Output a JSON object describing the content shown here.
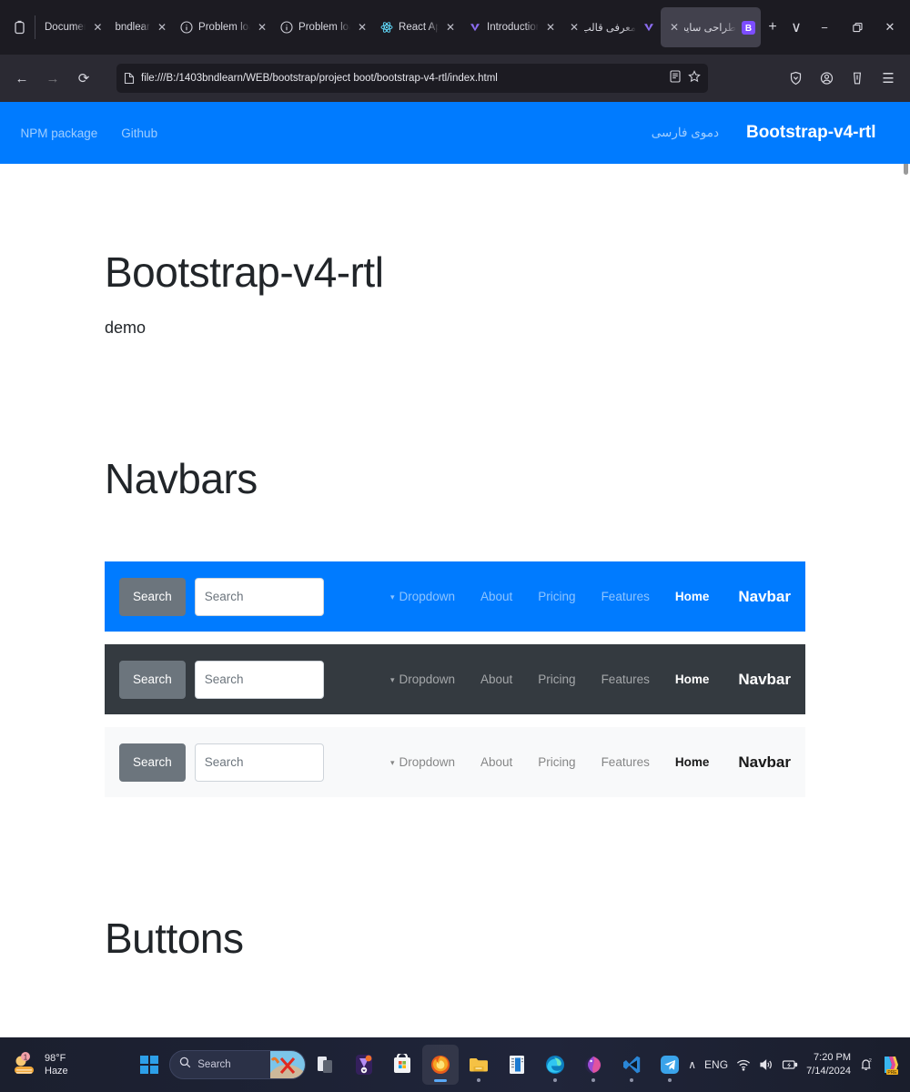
{
  "browser": {
    "tabs": [
      {
        "title": "Document",
        "favicon": "",
        "close": "✕",
        "active": false,
        "rtl": false
      },
      {
        "title": "bndlearn",
        "favicon": "",
        "close": "✕",
        "active": false,
        "rtl": false
      },
      {
        "title": "Problem loading page",
        "favicon": "info-circle-icon",
        "close": "✕",
        "active": false,
        "rtl": false
      },
      {
        "title": "Problem loading page",
        "favicon": "info-circle-icon",
        "close": "✕",
        "active": false,
        "rtl": false
      },
      {
        "title": "React App",
        "favicon": "react-icon",
        "close": "✕",
        "active": false,
        "rtl": false
      },
      {
        "title": "Introduction | W",
        "favicon": "v-icon",
        "close": "✕",
        "active": false,
        "rtl": false
      },
      {
        "title": "معرفی قالب دانلود",
        "favicon": "v-icon",
        "close": "✕",
        "active": false,
        "rtl": true
      },
      {
        "title": "طراحی سایت بندلرن",
        "favicon": "b-icon",
        "close": "✕",
        "active": true,
        "rtl": true
      }
    ],
    "new_tab_label": "+",
    "tab_list_label": "∨",
    "window_controls": {
      "minimize": "−",
      "maximize": "❐",
      "close": "✕"
    },
    "toolbar": {
      "back": "←",
      "forward": "→",
      "reload": "⟳",
      "url": "file:///B:/1403bndlearn/WEB/bootstrap/project boot/bootstrap-v4-rtl/index.html",
      "reader_label": "reader-view-icon",
      "bookmark_label": "☆",
      "shield_label": "shield-icon",
      "account_label": "account-icon",
      "save_to_pocket_label": "pocket-icon",
      "menu_label": "☰"
    }
  },
  "site": {
    "navbar": {
      "brand": "Bootstrap-v4-rtl",
      "links": [
        {
          "label": "دموی فارسی"
        }
      ],
      "right_links": [
        {
          "label": "NPM package"
        },
        {
          "label": "Github"
        }
      ]
    },
    "jumbotron": {
      "title": "Bootstrap-v4-rtl",
      "subtitle": "demo"
    },
    "sections": [
      {
        "title": "Navbars"
      },
      {
        "title": "Buttons"
      }
    ],
    "navbar_examples": [
      {
        "variant": "primary",
        "brand": "Navbar",
        "links": [
          {
            "label": "Home",
            "active": true
          },
          {
            "label": "Features",
            "active": false
          },
          {
            "label": "Pricing",
            "active": false
          },
          {
            "label": "About",
            "active": false
          },
          {
            "label": "Dropdown",
            "active": false,
            "caret": "▾"
          }
        ],
        "search_placeholder": "Search",
        "search_button": "Search"
      },
      {
        "variant": "dark",
        "brand": "Navbar",
        "links": [
          {
            "label": "Home",
            "active": true
          },
          {
            "label": "Features",
            "active": false
          },
          {
            "label": "Pricing",
            "active": false
          },
          {
            "label": "About",
            "active": false
          },
          {
            "label": "Dropdown",
            "active": false,
            "caret": "▾"
          }
        ],
        "search_placeholder": "Search",
        "search_button": "Search"
      },
      {
        "variant": "light",
        "brand": "Navbar",
        "links": [
          {
            "label": "Home",
            "active": true
          },
          {
            "label": "Features",
            "active": false
          },
          {
            "label": "Pricing",
            "active": false
          },
          {
            "label": "About",
            "active": false
          },
          {
            "label": "Dropdown",
            "active": false,
            "caret": "▾"
          }
        ],
        "search_placeholder": "Search",
        "search_button": "Search"
      }
    ],
    "colors": {
      "primary": "#007bff",
      "dark": "#343a40",
      "light": "#f8f9fa",
      "secondary": "#6c757d"
    }
  },
  "taskbar": {
    "weather": {
      "temperature": "98°F",
      "condition": "Haze"
    },
    "search_placeholder": "Search",
    "start_label": "start-button",
    "apps": [
      {
        "name": "widgets-icon",
        "running": false
      },
      {
        "name": "copilot-icon",
        "running": false
      },
      {
        "name": "microsoft-store-icon",
        "running": false
      },
      {
        "name": "firefox-icon",
        "running": true,
        "active": true
      },
      {
        "name": "file-explorer-icon",
        "running": true
      },
      {
        "name": "word-icon",
        "running": false
      },
      {
        "name": "microsoft-edge-icon",
        "running": true
      },
      {
        "name": "firefox-developer-icon",
        "running": true
      },
      {
        "name": "vs-code-icon",
        "running": true
      },
      {
        "name": "telegram-icon",
        "running": true
      }
    ],
    "tray": {
      "chevron": "∧",
      "language": "ENG",
      "wifi": "wifi-icon",
      "volume": "volume-icon",
      "battery": "battery-charging-icon",
      "time": "7:20 PM",
      "date": "7/14/2024",
      "notifications": "notification-bell-icon",
      "copilot_badge": "PRE"
    }
  }
}
